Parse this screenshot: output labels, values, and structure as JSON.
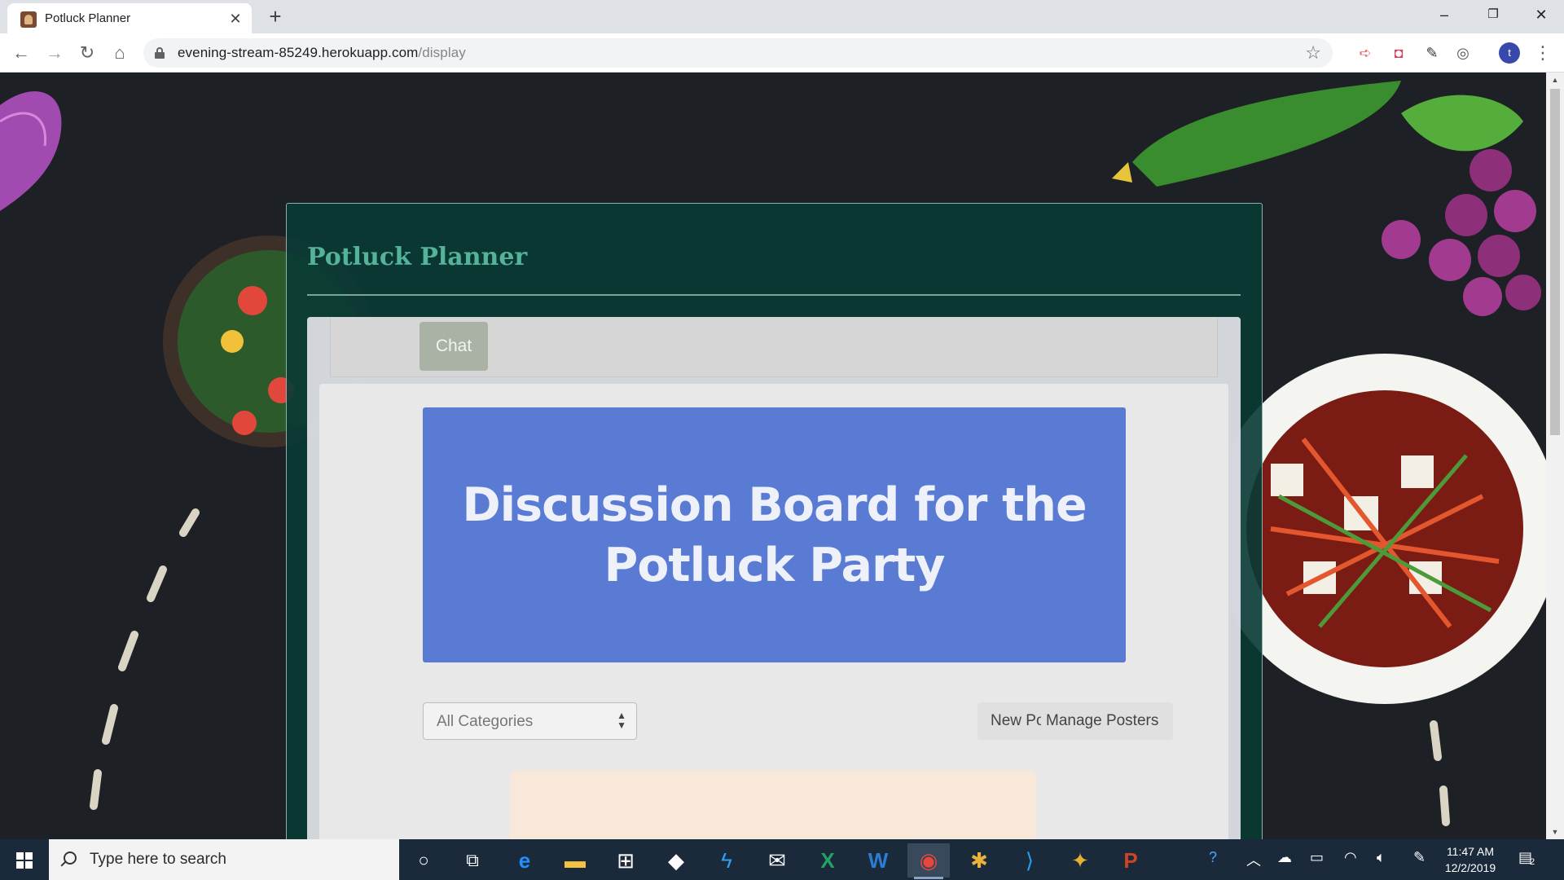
{
  "browser": {
    "tab_title": "Potluck Planner",
    "tab_close": "✕",
    "new_tab": "+",
    "url_host": "evening-stream-85249.herokuapp.com",
    "url_path": "/display",
    "window_controls": {
      "minimize": "–",
      "maximize": "❐",
      "close": "✕"
    }
  },
  "page": {
    "brand": "Potluck Planner",
    "nav": {
      "chat_label": "Chat"
    },
    "hero_title": "Discussion Board for the Potluck Party",
    "category_select": {
      "selected": "All Categories"
    },
    "buttons": {
      "new_post": "New Post",
      "manage_posters": "Manage Posters"
    }
  },
  "taskbar": {
    "search_placeholder": "Type here to search",
    "time": "11:47 AM",
    "date": "12/2/2019",
    "notification_count": "2"
  },
  "colors": {
    "page_background": "#1d2024",
    "card_background": "#093a34",
    "brand_text": "#54b39a",
    "hero_background": "#5477d2",
    "taskbar": "#1b2a3b"
  }
}
